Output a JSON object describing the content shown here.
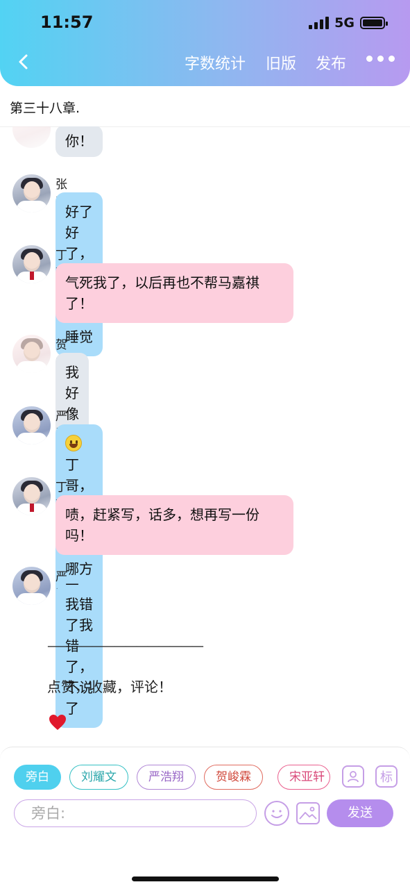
{
  "status_bar": {
    "time": "11:57",
    "network": "5G"
  },
  "header": {
    "nav": [
      "字数统计",
      "旧版",
      "发布"
    ],
    "colors": {
      "gradient_start": "#52d3f3",
      "gradient_end": "#b79af0"
    }
  },
  "chapter_title": "第三十八章.",
  "messages": [
    {
      "speaker": "",
      "text": "你！",
      "style": "gray"
    },
    {
      "speaker": "张真源",
      "text": "好了好了，快写吧，写完睡觉",
      "style": "blue"
    },
    {
      "speaker": "丁程鑫",
      "text": "气死我了，以后再也不帮马嘉祺了！",
      "style": "pink"
    },
    {
      "speaker": "贺峻霖",
      "text": "我好像听到了什么不得了的东西",
      "style": "gray"
    },
    {
      "speaker": "严浩翔",
      "text": "丁哥，你帮的，是…哪方面",
      "style": "blue",
      "emoji": "smiley-emoji"
    },
    {
      "speaker": "丁程鑫",
      "text": "啧，赶紧写，话多，想再写一份吗！",
      "style": "pink"
    },
    {
      "speaker": "严浩翔",
      "text": "我错了我错了，不说了",
      "style": "blue"
    }
  ],
  "footer": {
    "rule": "——————————————",
    "text": "点赞，收藏，评论！",
    "heart_icon": "red-heart-icon"
  },
  "role_chips": [
    "旁白",
    "刘耀文",
    "严浩翔",
    "贺峻霖",
    "宋亚轩"
  ],
  "tools": {
    "mark_label": "标",
    "person_icon": "person-icon",
    "emoji_icon": "emoji-icon",
    "image_icon": "image-icon"
  },
  "composer": {
    "placeholder": "旁白:",
    "send_label": "发送"
  }
}
